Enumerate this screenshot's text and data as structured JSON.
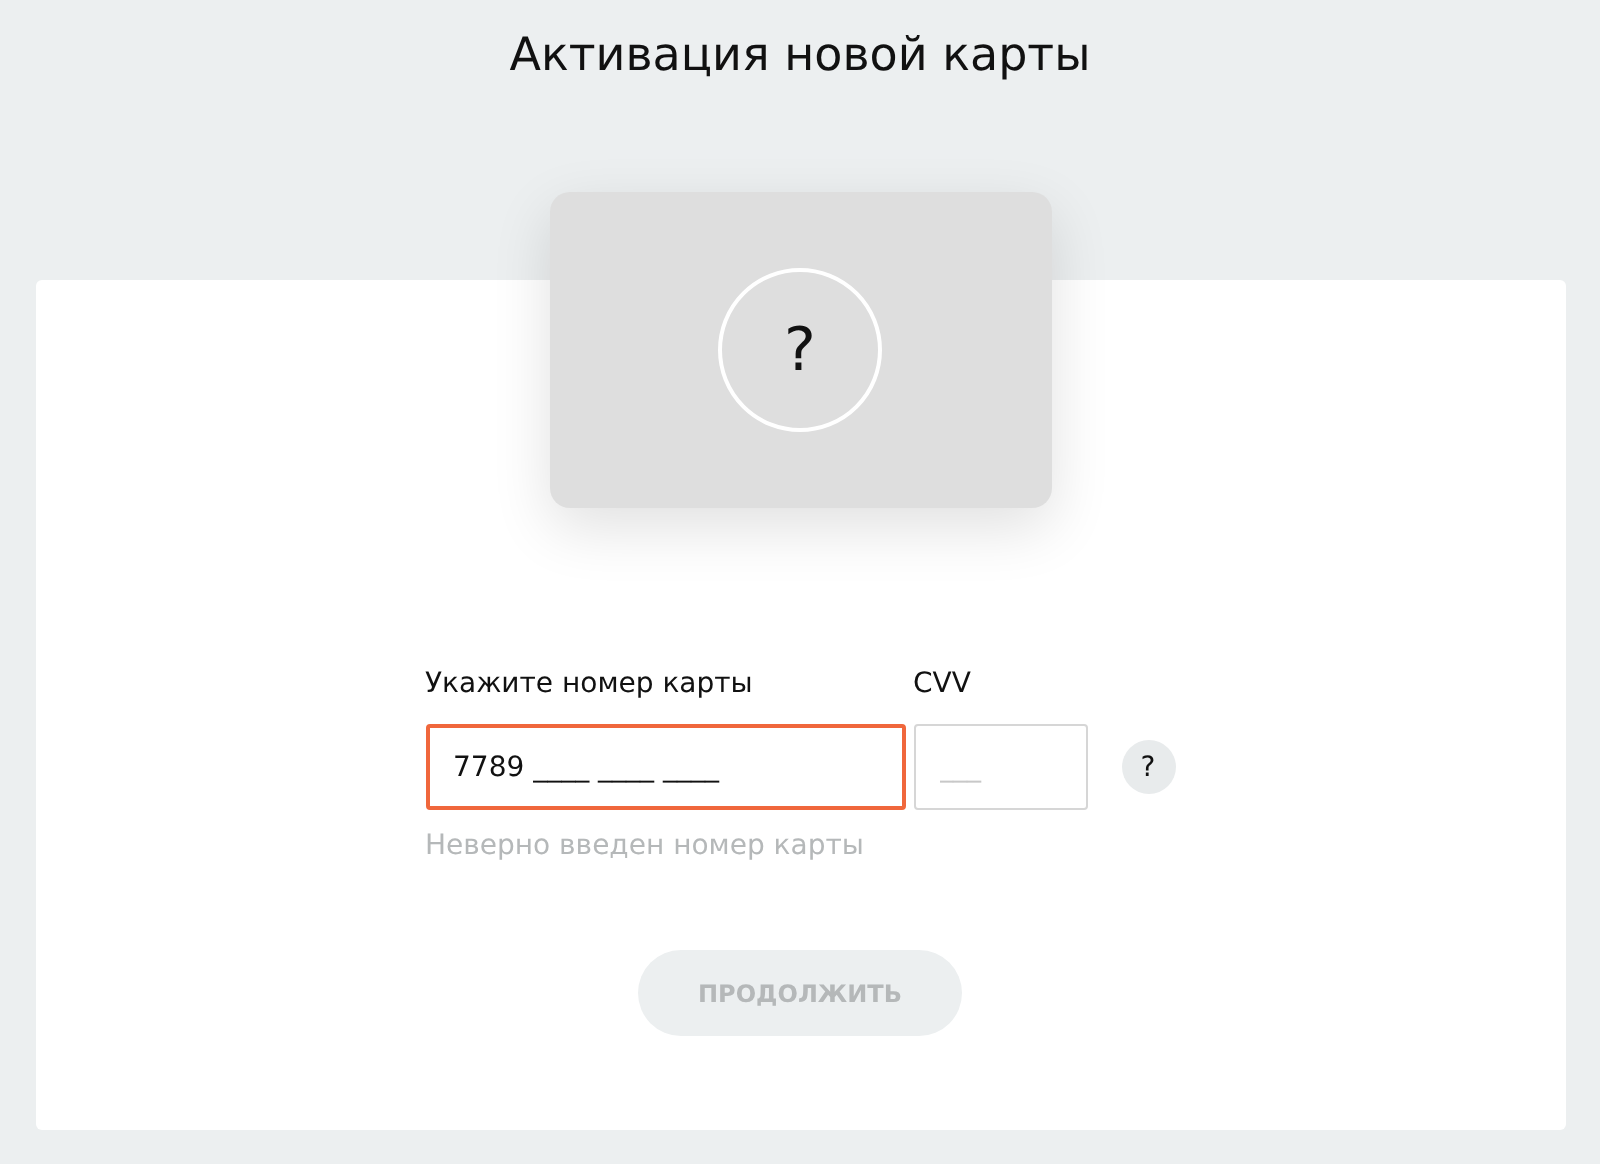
{
  "title": "Активация новой карты",
  "card_preview": {
    "symbol": "?"
  },
  "card_number": {
    "label": "Укажите номер карты",
    "value": "7789 ____ ____ ____",
    "error": true,
    "error_text": "Неверно введен номер карты"
  },
  "cvv": {
    "label": "CVV",
    "placeholder": "___",
    "help": "?"
  },
  "continue_button": {
    "label": "ПРОДОЛЖИТЬ",
    "disabled": true
  }
}
